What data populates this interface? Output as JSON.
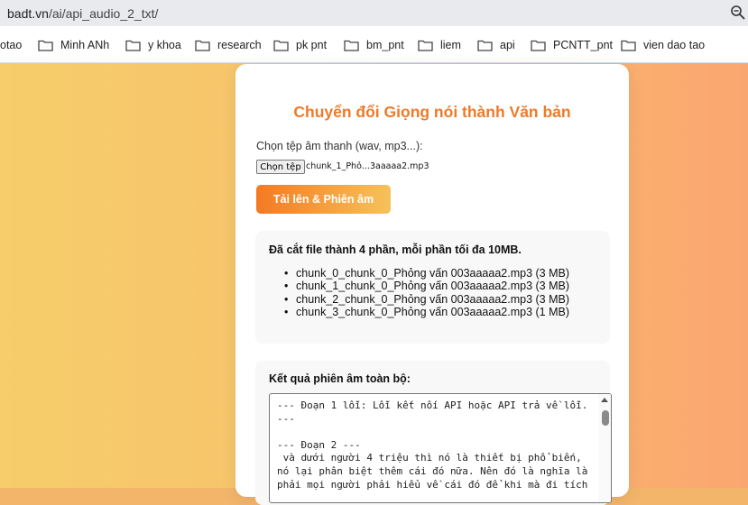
{
  "browser": {
    "url_host": "badt.vn",
    "url_path": "/ai/api_audio_2_txt/",
    "bookmarks": [
      {
        "label": "otao",
        "icon": "folder-icon"
      },
      {
        "label": "Minh ANh",
        "icon": "folder-icon"
      },
      {
        "label": "y khoa",
        "icon": "folder-icon"
      },
      {
        "label": "research",
        "icon": "folder-icon"
      },
      {
        "label": "pk pnt",
        "icon": "folder-icon"
      },
      {
        "label": "bm_pnt",
        "icon": "folder-icon"
      },
      {
        "label": "liem",
        "icon": "folder-icon"
      },
      {
        "label": "api",
        "icon": "folder-icon"
      },
      {
        "label": "PCNTT_pnt",
        "icon": "folder-icon"
      },
      {
        "label": "vien dao tao",
        "icon": "folder-icon"
      }
    ]
  },
  "colors": {
    "title": "#ee7a2a",
    "button_start": "#f47a22",
    "button_end": "#f6c25a",
    "page_bg_start": "#f6cd6a",
    "page_bg_end": "#faa670"
  },
  "form": {
    "title": "Chuyển đổi Giọng nói thành Văn bản",
    "file_label": "Chọn tệp âm thanh (wav, mp3...):",
    "choose_button": "Chọn tệp",
    "file_name": "chunk_1_Phỏ...3aaaaa2.mp3",
    "upload_button": "Tải lên & Phiên âm"
  },
  "split_info": {
    "title": "Đã cắt file thành 4 phần, mỗi phần tối đa 10MB.",
    "chunks": [
      "chunk_0_chunk_0_Phỏng vấn 003aaaaa2.mp3 (3 MB)",
      "chunk_1_chunk_0_Phỏng vấn 003aaaaa2.mp3 (3 MB)",
      "chunk_2_chunk_0_Phỏng vấn 003aaaaa2.mp3 (3 MB)",
      "chunk_3_chunk_0_Phỏng vấn 003aaaaa2.mp3 (1 MB)"
    ]
  },
  "result": {
    "title": "Kết quả phiên âm toàn bộ:",
    "text": "--- Đoạn 1 lỗi: Lỗi kết nối API hoặc API trả về lỗi. ---\n\n--- Đoạn 2 ---\n và dưới người 4 triệu thì nó là thiết bị phổ biến, nó lại phân biệt thêm cái đó nữa. Nên đó là nghĩa là phải mọi người phải hiểu về cái đó để khi mà đi tích"
  }
}
